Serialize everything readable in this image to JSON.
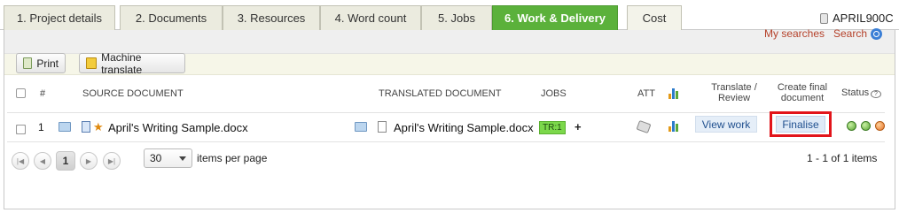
{
  "tabs": [
    {
      "label": "1. Project details"
    },
    {
      "label": "2. Documents"
    },
    {
      "label": "3. Resources"
    },
    {
      "label": "4. Word count"
    },
    {
      "label": "5. Jobs"
    },
    {
      "label": "6. Work & Delivery"
    },
    {
      "label": "Cost"
    }
  ],
  "active_tab": "6. Work & Delivery",
  "project_code": "APRIL900C",
  "search": {
    "my_searches": "My searches",
    "search": "Search"
  },
  "toolbar": {
    "print_label": "Print",
    "machine_translate_label": "Machine translate"
  },
  "table": {
    "headers": {
      "number": "#",
      "source": "SOURCE DOCUMENT",
      "translated": "TRANSLATED DOCUMENT",
      "jobs": "JOBS",
      "att": "ATT",
      "translate_review_1": "Translate /",
      "translate_review_2": "Review",
      "create_final_1": "Create final",
      "create_final_2": "document",
      "status": "Status"
    },
    "rows": [
      {
        "number": "1",
        "source_document": "April's Writing Sample.docx",
        "translated_document": "April's Writing Sample.docx",
        "job_badge": "TR:1",
        "job_add": "+",
        "view_work": "View work",
        "finalise": "Finalise"
      }
    ]
  },
  "pager": {
    "current_page": "1",
    "items_per_page": "30",
    "items_per_page_label": "items per page",
    "count_text": "1 - 1 of 1 items"
  },
  "colors": {
    "active_tab": "#5bb13b",
    "highlight_border": "#e2141a",
    "link": "#b5412a"
  }
}
